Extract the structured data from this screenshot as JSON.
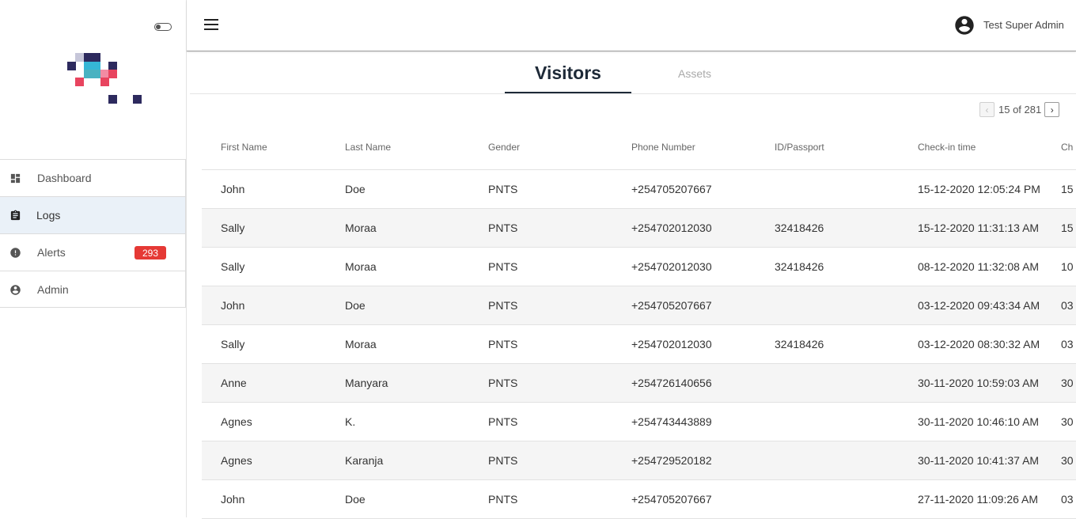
{
  "user": {
    "name": "Test Super Admin"
  },
  "sidebar": {
    "items": [
      {
        "label": "Dashboard",
        "icon": "dashboard-icon"
      },
      {
        "label": "Logs",
        "icon": "clipboard-icon",
        "active": true
      },
      {
        "label": "Alerts",
        "icon": "alert-icon",
        "badge": "293"
      },
      {
        "label": "Admin",
        "icon": "account-circle-icon"
      }
    ]
  },
  "tabs": {
    "visitors": "Visitors",
    "assets": "Assets"
  },
  "pager": {
    "prev": "‹",
    "next": "›",
    "text": "15 of 281"
  },
  "table": {
    "headers": [
      "First Name",
      "Last Name",
      "Gender",
      "Phone Number",
      "ID/Passport",
      "Check-in time",
      "Ch"
    ],
    "rows": [
      [
        "John",
        "Doe",
        "PNTS",
        "+254705207667",
        "",
        "15-12-2020 12:05:24 PM",
        "15"
      ],
      [
        "Sally",
        "Moraa",
        "PNTS",
        "+254702012030",
        "32418426",
        "15-12-2020 11:31:13 AM",
        "15"
      ],
      [
        "Sally",
        "Moraa",
        "PNTS",
        "+254702012030",
        "32418426",
        "08-12-2020 11:32:08 AM",
        "10"
      ],
      [
        "John",
        "Doe",
        "PNTS",
        "+254705207667",
        "",
        "03-12-2020 09:43:34 AM",
        "03"
      ],
      [
        "Sally",
        "Moraa",
        "PNTS",
        "+254702012030",
        "32418426",
        "03-12-2020 08:30:32 AM",
        "03"
      ],
      [
        "Anne",
        "Manyara",
        "PNTS",
        "+254726140656",
        "",
        "30-11-2020 10:59:03 AM",
        "30"
      ],
      [
        "Agnes",
        "K.",
        "PNTS",
        "+254743443889",
        "",
        "30-11-2020 10:46:10 AM",
        "30"
      ],
      [
        "Agnes",
        "Karanja",
        "PNTS",
        "+254729520182",
        "",
        "30-11-2020 10:41:37 AM",
        "30"
      ],
      [
        "John",
        "Doe",
        "PNTS",
        "+254705207667",
        "",
        "27-11-2020 11:09:26 AM",
        "03"
      ]
    ]
  },
  "colors": {
    "active_nav": "#eaf1f8",
    "badge": "#e53935",
    "tab_active": "#1e2a38"
  }
}
